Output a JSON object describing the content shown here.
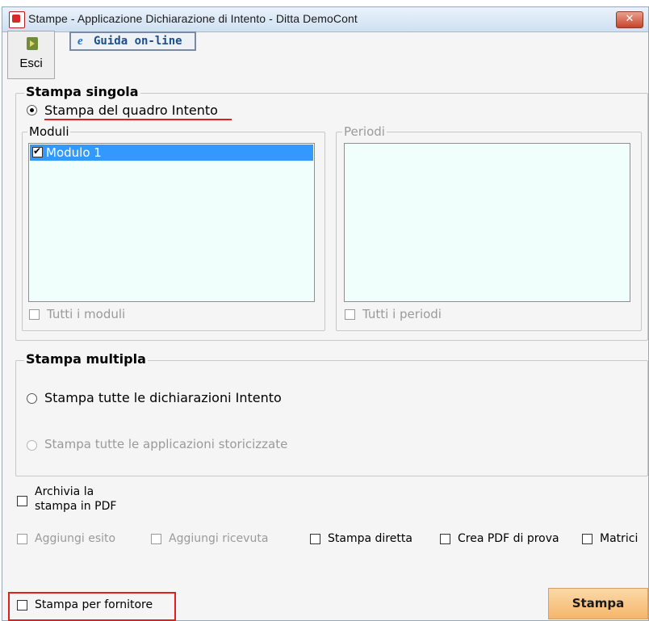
{
  "window": {
    "title": "Stampe - Applicazione Dichiarazione di Intento - Ditta  DemoCont",
    "close_label": "✕"
  },
  "toolbar": {
    "esci_label": "Esci",
    "guida_label": "Guida on-line",
    "guida_icon": "e"
  },
  "stampa_singola": {
    "legend": "Stampa singola",
    "option_label": "Stampa del quadro Intento",
    "moduli": {
      "legend": "Moduli",
      "items": [
        {
          "label": "Modulo 1",
          "checked": true,
          "selected": true
        }
      ],
      "tutti_label": "Tutti i moduli"
    },
    "periodi": {
      "legend": "Periodi",
      "tutti_label": "Tutti i periodi"
    }
  },
  "stampa_multipla": {
    "legend": "Stampa multipla",
    "option1_label": "Stampa tutte le dichiarazioni Intento",
    "option2_label": "Stampa tutte le applicazioni storicizzate"
  },
  "options": {
    "archivia_line1": "Archivia la",
    "archivia_line2": "stampa in PDF",
    "aggiungi_esito": "Aggiungi esito",
    "aggiungi_ricevuta": "Aggiungi ricevuta",
    "stampa_diretta": "Stampa diretta",
    "crea_pdf": "Crea PDF di prova",
    "matrici": "Matrici",
    "stampa_per_fornitore": "Stampa per fornitore"
  },
  "buttons": {
    "stampa_label": "Stampa"
  },
  "colors": {
    "selection": "#3399ff",
    "listbox_bg": "#f0fffb",
    "highlight_red": "#e02020",
    "stampa_button": "#f5b66a"
  }
}
